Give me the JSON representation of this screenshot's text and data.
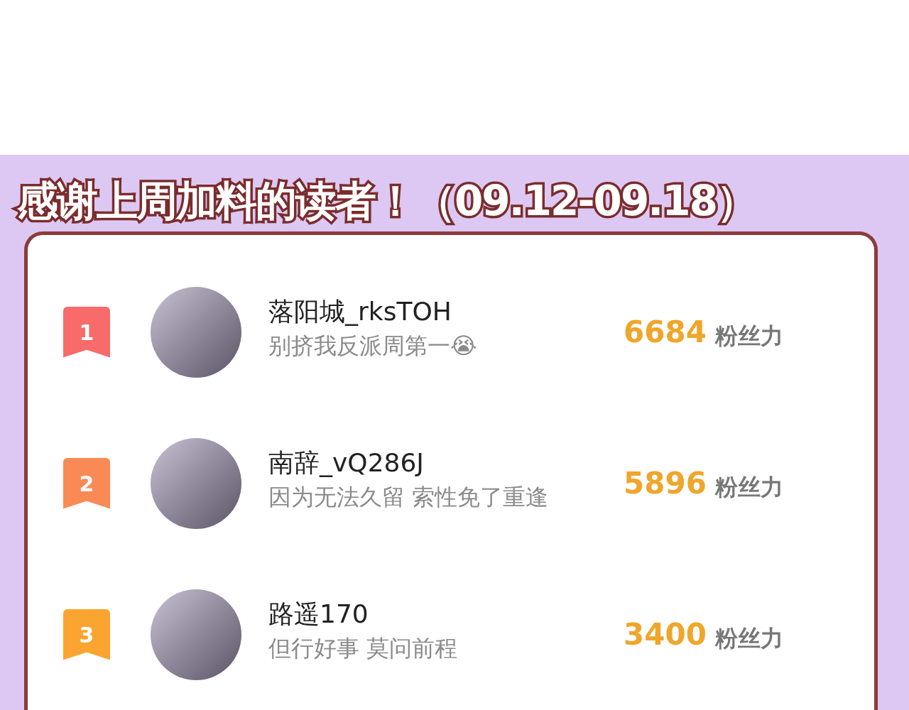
{
  "title": "感谢上周加料的读者！（09.12-09.18）",
  "readers": [
    {
      "rank": "1",
      "color": "#f76b6b",
      "name": "落阳城_rksTOH",
      "motto": "别挤我反派周第一😭",
      "score": "6684",
      "unit": "粉丝力"
    },
    {
      "rank": "2",
      "color": "#f98a55",
      "name": "南辞_vQ286J",
      "motto": "因为无法久留 索性免了重逢",
      "score": "5896",
      "unit": "粉丝力"
    },
    {
      "rank": "3",
      "color": "#fba531",
      "name": "路遥170",
      "motto": "但行好事 莫问前程",
      "score": "3400",
      "unit": "粉丝力"
    }
  ]
}
